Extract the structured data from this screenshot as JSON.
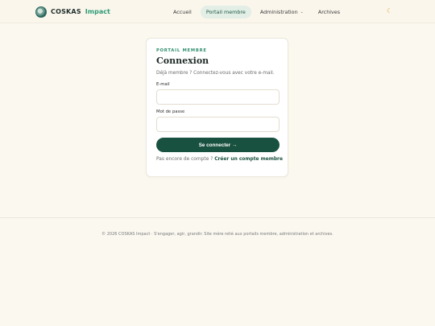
{
  "header": {
    "brand_name": "COSKAS",
    "brand_accent": "Impact",
    "nav": [
      {
        "label": "Accueil"
      },
      {
        "label": "Portail membre",
        "active": true
      },
      {
        "label": "Administration"
      },
      {
        "label": "Archives"
      }
    ],
    "theme_icon": "moon-icon"
  },
  "login": {
    "eyebrow": "PORTAIL MEMBRE",
    "title": "Connexion",
    "subtitle": "Déjà membre ? Connectez-vous avec votre e-mail.",
    "email_label": "E-mail",
    "email_value": "",
    "password_label": "Mot de passe",
    "password_value": "",
    "submit_label": "Se connecter →",
    "signup_prompt": "Pas encore de compte ?",
    "signup_link": "Créer un compte membre"
  },
  "footer": {
    "text": "© 2026 COSKAS Impact · S'engager, agir, grandir. Site mère relié aux portails membre, administration et archives."
  },
  "colors": {
    "accent": "#2e9a76",
    "button": "#18513f",
    "background": "#fbf8f0"
  }
}
